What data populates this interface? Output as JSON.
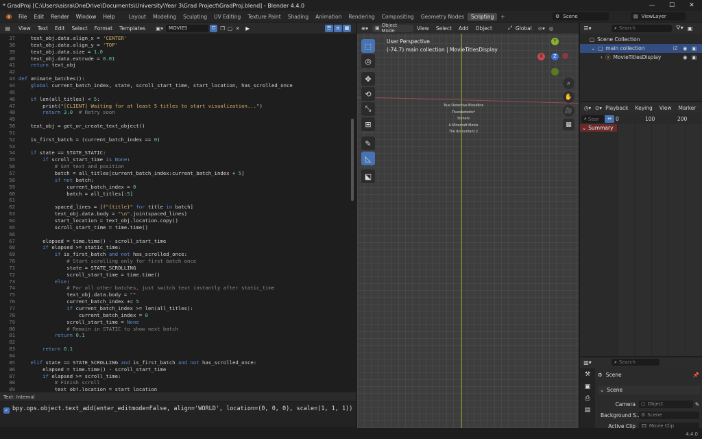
{
  "window": {
    "title": "* GradProj [C:\\Users\\aisra\\OneDrive\\Documents\\University\\Year 3\\Grad Project\\GradProj.blend] - Blender 4.4.0",
    "minimize": "—",
    "maximize": "☐",
    "close": "✕"
  },
  "menubar": {
    "items": [
      "File",
      "Edit",
      "Render",
      "Window",
      "Help"
    ],
    "workspaces": [
      "Layout",
      "Modeling",
      "Sculpting",
      "UV Editing",
      "Texture Paint",
      "Shading",
      "Animation",
      "Rendering",
      "Compositing",
      "Geometry Nodes",
      "Scripting"
    ],
    "active_workspace": "Scripting",
    "add_workspace": "+",
    "scene": "Scene",
    "view_layer": "ViewLayer"
  },
  "text_editor": {
    "menus": [
      "View",
      "Text",
      "Edit",
      "Select",
      "Format",
      "Templates"
    ],
    "text_name": "MOVIES",
    "footer": "Text: Internal",
    "lines": [
      {
        "n": "37",
        "t": "    text_obj.data.align_x = 'CENTER'"
      },
      {
        "n": "38",
        "t": "    text_obj.data.align_y = 'TOP'"
      },
      {
        "n": "39",
        "t": "    text_obj.data.size = 1.0"
      },
      {
        "n": "40",
        "t": "    text_obj.data.extrude = 0.01"
      },
      {
        "n": "41",
        "t": "    return text_obj"
      },
      {
        "n": "42",
        "t": ""
      },
      {
        "n": "43",
        "t": "def animate_batches():"
      },
      {
        "n": "44",
        "t": "    global current_batch_index, state, scroll_start_time, start_location, has_scrolled_once"
      },
      {
        "n": "45",
        "t": ""
      },
      {
        "n": "46",
        "t": "    if len(all_titles) < 5:"
      },
      {
        "n": "47",
        "t": "        print(\"[CLIENT] Waiting for at least 5 titles to start visualization...\")"
      },
      {
        "n": "48",
        "t": "        return 3.0  # Retry soon"
      },
      {
        "n": "49",
        "t": ""
      },
      {
        "n": "50",
        "t": "    text_obj = get_or_create_text_object()"
      },
      {
        "n": "51",
        "t": ""
      },
      {
        "n": "52",
        "t": "    is_first_batch = (current_batch_index == 0)"
      },
      {
        "n": "53",
        "t": ""
      },
      {
        "n": "54",
        "t": "    if state == STATE_STATIC:"
      },
      {
        "n": "55",
        "t": "        if scroll_start_time is None:"
      },
      {
        "n": "56",
        "t": "            # Set text and position"
      },
      {
        "n": "57",
        "t": "            batch = all_titles[current_batch_index:current_batch_index + 5]"
      },
      {
        "n": "58",
        "t": "            if not batch:"
      },
      {
        "n": "59",
        "t": "                current_batch_index = 0"
      },
      {
        "n": "60",
        "t": "                batch = all_titles[:5]"
      },
      {
        "n": "61",
        "t": ""
      },
      {
        "n": "62",
        "t": "            spaced_lines = [f\"{title}\" for title in batch]"
      },
      {
        "n": "63",
        "t": "            text_obj.data.body = \"\\n\".join(spaced_lines)"
      },
      {
        "n": "64",
        "t": "            start_location = text_obj.location.copy()"
      },
      {
        "n": "65",
        "t": "            scroll_start_time = time.time()"
      },
      {
        "n": "66",
        "t": ""
      },
      {
        "n": "67",
        "t": "        elapsed = time.time() - scroll_start_time"
      },
      {
        "n": "68",
        "t": "        if elapsed >= static_time:"
      },
      {
        "n": "69",
        "t": "            if is_first_batch and not has_scrolled_once:"
      },
      {
        "n": "70",
        "t": "                # Start scrolling only for first batch once"
      },
      {
        "n": "71",
        "t": "                state = STATE_SCROLLING"
      },
      {
        "n": "72",
        "t": "                scroll_start_time = time.time()"
      },
      {
        "n": "73",
        "t": "            else:"
      },
      {
        "n": "74",
        "t": "                # For all other batches, just switch text instantly after static_time"
      },
      {
        "n": "75",
        "t": "                text_obj.data.body = \"\""
      },
      {
        "n": "76",
        "t": "                current_batch_index += 5"
      },
      {
        "n": "77",
        "t": "                if current_batch_index >= len(all_titles):"
      },
      {
        "n": "78",
        "t": "                    current_batch_index = 0"
      },
      {
        "n": "79",
        "t": "                scroll_start_time = None"
      },
      {
        "n": "80",
        "t": "                # Remain in STATIC to show next batch"
      },
      {
        "n": "81",
        "t": "            return 0.1"
      },
      {
        "n": "82",
        "t": ""
      },
      {
        "n": "83",
        "t": "        return 0.1"
      },
      {
        "n": "84",
        "t": ""
      },
      {
        "n": "85",
        "t": "    elif state == STATE_SCROLLING and is_first_batch and not has_scrolled_once:"
      },
      {
        "n": "86",
        "t": "        elapsed = time.time() - scroll_start_time"
      },
      {
        "n": "87",
        "t": "        if elapsed >= scroll_time:"
      },
      {
        "n": "88",
        "t": "            # Finish scroll"
      },
      {
        "n": "89",
        "t": "            text_obj.location = start_location"
      }
    ]
  },
  "console": {
    "command": "bpy.ops.object.text_add(enter_editmode=False, align='WORLD', location=(0, 0, 0), scale=(1, 1, 1))"
  },
  "viewport": {
    "mode": "Object Mode",
    "menus": [
      "View",
      "Select",
      "Add",
      "Object"
    ],
    "orientation": "Global",
    "perspective": "User Perspective",
    "collection_info": "(-74.7) main collection | MovieTitlesDisplay",
    "movie_titles": [
      "True Detective Bloodline",
      "Thunderbolts*",
      "Sinners",
      "A Minecraft Movie",
      "The Accountant 2"
    ],
    "gizmo": {
      "x": "X",
      "y": "Y",
      "z": "Z"
    },
    "colors": {
      "x_axis": "#c8494f",
      "y_axis": "#8cb32c",
      "z_axis": "#3b6fd6"
    }
  },
  "outliner": {
    "search_placeholder": "Search",
    "root": "Scene Collection",
    "collection": "main collection",
    "object": "MovieTitlesDisplay"
  },
  "dopesheet": {
    "menus": [
      "Playback",
      "Keying",
      "View",
      "Marker"
    ],
    "search_placeholder": "Sear",
    "ticks": [
      "0",
      "100",
      "200"
    ],
    "summary": "Summary"
  },
  "properties": {
    "search_placeholder": "Search",
    "scene_name": "Scene",
    "panel": "Scene",
    "rows": [
      {
        "label": "Camera",
        "placeholder": "Object"
      },
      {
        "label": "Background S...",
        "placeholder": "Scene"
      },
      {
        "label": "Active Clip",
        "placeholder": "Movie Clip"
      }
    ]
  },
  "statusbar": {
    "version": "4.4.0"
  }
}
